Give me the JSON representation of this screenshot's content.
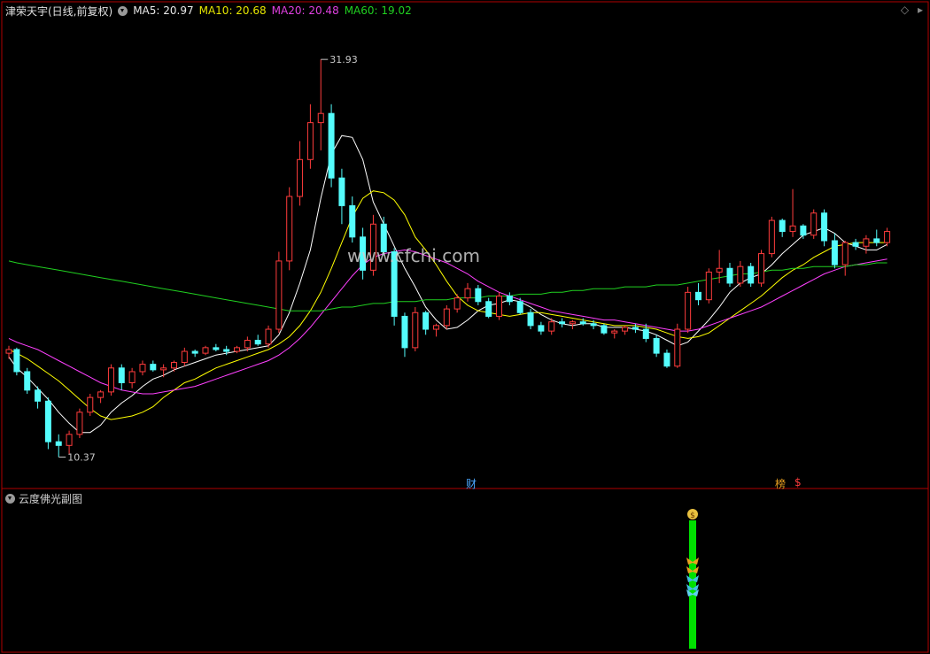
{
  "header": {
    "stock_title": "津荣天宇(日线,前复权)",
    "ma5": "MA5: 20.97",
    "ma10": "MA10: 20.68",
    "ma20": "MA20: 20.48",
    "ma60": "MA60: 19.02"
  },
  "indicator_panel": {
    "title": "云度佛光副图"
  },
  "markers": {
    "cai": "财",
    "bang": "榜",
    "dollar": "$"
  },
  "watermark": "www.cfchi.com",
  "top_right_icons": [
    "diamond-icon",
    "caret-icon"
  ],
  "colors": {
    "up": "#ff3c3c",
    "down": "#54fcfc",
    "ma5": "#ffffff",
    "ma10": "#ffff00",
    "ma20": "#ff40ff",
    "ma60": "#20d020",
    "border": "#b00000",
    "signal_bar": "#00e000"
  },
  "chart_data": {
    "type": "candlestick",
    "annotations": {
      "high_label": "31.93",
      "low_label": "10.37"
    },
    "ylim": [
      9.0,
      34.0
    ],
    "candles": [
      [
        16.0,
        16.4,
        15.7,
        16.2
      ],
      [
        16.2,
        16.3,
        14.8,
        15.0
      ],
      [
        15.0,
        15.2,
        13.8,
        14.0
      ],
      [
        14.0,
        14.2,
        13.0,
        13.4
      ],
      [
        13.4,
        13.6,
        10.8,
        11.2
      ],
      [
        11.2,
        11.6,
        10.37,
        11.0
      ],
      [
        11.0,
        11.8,
        10.5,
        11.6
      ],
      [
        11.6,
        13.0,
        11.4,
        12.8
      ],
      [
        12.8,
        13.8,
        12.6,
        13.6
      ],
      [
        13.6,
        14.0,
        13.3,
        13.9
      ],
      [
        13.9,
        15.4,
        13.7,
        15.2
      ],
      [
        15.2,
        15.4,
        14.0,
        14.4
      ],
      [
        14.4,
        15.2,
        14.1,
        15.0
      ],
      [
        15.0,
        15.6,
        14.8,
        15.4
      ],
      [
        15.4,
        15.6,
        15.0,
        15.1
      ],
      [
        15.1,
        15.4,
        14.7,
        15.2
      ],
      [
        15.2,
        15.6,
        15.0,
        15.5
      ],
      [
        15.5,
        16.3,
        15.3,
        16.1
      ],
      [
        16.1,
        16.2,
        15.8,
        16.0
      ],
      [
        16.0,
        16.4,
        15.9,
        16.3
      ],
      [
        16.3,
        16.5,
        16.1,
        16.2
      ],
      [
        16.2,
        16.4,
        15.9,
        16.1
      ],
      [
        16.1,
        16.4,
        16.0,
        16.3
      ],
      [
        16.3,
        16.9,
        16.1,
        16.7
      ],
      [
        16.7,
        17.0,
        16.4,
        16.5
      ],
      [
        16.5,
        17.5,
        16.3,
        17.3
      ],
      [
        17.3,
        21.5,
        17.1,
        21.0
      ],
      [
        21.0,
        25.0,
        20.5,
        24.5
      ],
      [
        24.5,
        27.5,
        24.0,
        26.5
      ],
      [
        26.5,
        29.5,
        26.0,
        28.5
      ],
      [
        28.5,
        31.93,
        27.0,
        29.0
      ],
      [
        29.0,
        29.5,
        25.0,
        25.5
      ],
      [
        25.5,
        26.0,
        23.0,
        24.0
      ],
      [
        24.0,
        24.5,
        22.0,
        22.3
      ],
      [
        22.3,
        22.8,
        20.0,
        20.5
      ],
      [
        20.5,
        23.5,
        20.2,
        23.0
      ],
      [
        23.0,
        23.4,
        21.3,
        21.5
      ],
      [
        21.5,
        21.7,
        17.5,
        18.0
      ],
      [
        18.0,
        18.2,
        15.8,
        16.3
      ],
      [
        16.3,
        18.5,
        16.1,
        18.2
      ],
      [
        18.2,
        18.3,
        17.0,
        17.3
      ],
      [
        17.3,
        17.6,
        16.9,
        17.5
      ],
      [
        17.5,
        18.6,
        17.3,
        18.4
      ],
      [
        18.4,
        19.2,
        18.2,
        19.0
      ],
      [
        19.0,
        19.8,
        18.8,
        19.5
      ],
      [
        19.5,
        19.7,
        18.6,
        18.8
      ],
      [
        18.8,
        19.0,
        17.9,
        18.0
      ],
      [
        18.0,
        19.3,
        17.8,
        19.1
      ],
      [
        19.1,
        19.3,
        18.6,
        18.8
      ],
      [
        18.8,
        19.0,
        18.1,
        18.2
      ],
      [
        18.2,
        18.4,
        17.3,
        17.5
      ],
      [
        17.5,
        17.7,
        17.0,
        17.2
      ],
      [
        17.2,
        17.9,
        17.0,
        17.7
      ],
      [
        17.7,
        17.9,
        17.4,
        17.6
      ],
      [
        17.6,
        17.8,
        17.3,
        17.7
      ],
      [
        17.7,
        17.9,
        17.5,
        17.6
      ],
      [
        17.6,
        17.8,
        17.3,
        17.5
      ],
      [
        17.5,
        17.6,
        17.0,
        17.1
      ],
      [
        17.1,
        17.3,
        16.8,
        17.2
      ],
      [
        17.2,
        17.5,
        17.0,
        17.4
      ],
      [
        17.4,
        17.6,
        17.1,
        17.3
      ],
      [
        17.3,
        17.6,
        16.6,
        16.8
      ],
      [
        16.8,
        17.0,
        15.8,
        16.0
      ],
      [
        16.0,
        16.2,
        15.2,
        15.3
      ],
      [
        15.3,
        17.6,
        15.2,
        17.3
      ],
      [
        17.3,
        19.6,
        17.1,
        19.3
      ],
      [
        19.3,
        19.8,
        18.6,
        18.9
      ],
      [
        18.9,
        20.6,
        18.7,
        20.4
      ],
      [
        20.4,
        21.6,
        19.8,
        20.6
      ],
      [
        20.6,
        20.9,
        19.6,
        19.8
      ],
      [
        19.8,
        21.0,
        19.6,
        20.7
      ],
      [
        20.7,
        20.9,
        19.6,
        19.8
      ],
      [
        19.8,
        21.6,
        19.6,
        21.4
      ],
      [
        21.4,
        23.4,
        21.2,
        23.2
      ],
      [
        23.2,
        23.3,
        22.3,
        22.6
      ],
      [
        22.6,
        24.9,
        22.3,
        22.9
      ],
      [
        22.9,
        23.0,
        22.2,
        22.4
      ],
      [
        22.4,
        23.8,
        22.2,
        23.6
      ],
      [
        23.6,
        23.8,
        21.8,
        22.1
      ],
      [
        22.1,
        22.5,
        20.6,
        20.8
      ],
      [
        20.8,
        22.1,
        20.2,
        22.0
      ],
      [
        22.0,
        22.2,
        21.6,
        21.8
      ],
      [
        21.8,
        22.4,
        21.4,
        22.2
      ],
      [
        22.2,
        22.7,
        21.8,
        22.0
      ],
      [
        22.0,
        22.8,
        21.8,
        22.6
      ]
    ],
    "candle_x": [
      10,
      16,
      24,
      32,
      40,
      48,
      56,
      64,
      72,
      80,
      88,
      96,
      104,
      112,
      120,
      128,
      136,
      144,
      152,
      160,
      168,
      176,
      184,
      192,
      200,
      208,
      216,
      224,
      232,
      240,
      248,
      256,
      264,
      272,
      280,
      288,
      296,
      304,
      312,
      320,
      328,
      336,
      344,
      352,
      360,
      368,
      376,
      384,
      392,
      400,
      408,
      416,
      424,
      432,
      440,
      448,
      456,
      464,
      472,
      480,
      488,
      496,
      504,
      512,
      520,
      528,
      536,
      544,
      552,
      560,
      568,
      576,
      584,
      592,
      600,
      608,
      616,
      624,
      632,
      640,
      648,
      656,
      664,
      672,
      680
    ],
    "ma_lines": [
      {
        "key": "ma5",
        "values": [
          15.8,
          15.2,
          14.7,
          14.1,
          13.5,
          12.8,
          12.2,
          11.7,
          11.7,
          12.1,
          12.8,
          13.3,
          13.7,
          14.2,
          14.6,
          14.8,
          15.1,
          15.3,
          15.5,
          15.7,
          15.9,
          16.0,
          16.1,
          16.2,
          16.3,
          16.4,
          17.0,
          18.2,
          19.8,
          21.6,
          24.4,
          26.8,
          27.8,
          27.7,
          26.5,
          24.2,
          23.0,
          21.8,
          20.6,
          19.6,
          18.5,
          17.8,
          17.3,
          17.4,
          17.8,
          18.3,
          18.6,
          18.7,
          18.9,
          18.8,
          18.5,
          18.1,
          17.8,
          17.6,
          17.5,
          17.6,
          17.6,
          17.4,
          17.4,
          17.4,
          17.3,
          17.2,
          17.0,
          16.7,
          16.4,
          16.6,
          17.2,
          17.8,
          18.5,
          19.3,
          19.8,
          20.1,
          20.3,
          20.8,
          21.4,
          21.9,
          22.4,
          22.6,
          22.8,
          22.5,
          22.0,
          21.8,
          21.6,
          21.6,
          21.9
        ]
      },
      {
        "key": "ma10",
        "values": [
          16.2,
          16.0,
          15.7,
          15.3,
          14.9,
          14.5,
          14.0,
          13.5,
          13.0,
          12.6,
          12.4,
          12.5,
          12.6,
          12.8,
          13.1,
          13.6,
          14.0,
          14.4,
          14.6,
          14.9,
          15.2,
          15.4,
          15.6,
          15.8,
          16.0,
          16.2,
          16.5,
          16.9,
          17.5,
          18.3,
          19.3,
          20.6,
          22.0,
          23.4,
          24.4,
          24.8,
          24.7,
          24.3,
          23.5,
          22.3,
          21.6,
          20.8,
          19.9,
          19.1,
          18.6,
          18.3,
          18.2,
          18.1,
          18.0,
          18.1,
          18.2,
          18.2,
          18.1,
          18.0,
          17.9,
          17.8,
          17.7,
          17.6,
          17.5,
          17.5,
          17.5,
          17.4,
          17.3,
          17.1,
          16.9,
          16.8,
          16.9,
          17.1,
          17.5,
          17.9,
          18.3,
          18.7,
          19.1,
          19.6,
          20.1,
          20.5,
          20.8,
          21.2,
          21.5,
          21.8,
          21.9,
          22.0,
          22.0,
          22.0,
          22.0
        ]
      },
      {
        "key": "ma20",
        "values": [
          16.8,
          16.6,
          16.4,
          16.2,
          15.9,
          15.6,
          15.3,
          15.0,
          14.7,
          14.4,
          14.2,
          14.0,
          13.9,
          13.8,
          13.8,
          13.9,
          14.0,
          14.1,
          14.2,
          14.4,
          14.6,
          14.8,
          15.0,
          15.2,
          15.4,
          15.6,
          15.9,
          16.3,
          16.8,
          17.4,
          18.1,
          18.8,
          19.5,
          20.2,
          20.8,
          21.2,
          21.4,
          21.5,
          21.6,
          21.5,
          21.3,
          21.1,
          20.9,
          20.6,
          20.3,
          19.9,
          19.6,
          19.3,
          19.1,
          18.9,
          18.7,
          18.5,
          18.3,
          18.2,
          18.1,
          18.0,
          17.9,
          17.8,
          17.8,
          17.7,
          17.6,
          17.5,
          17.4,
          17.3,
          17.2,
          17.2,
          17.3,
          17.5,
          17.7,
          17.9,
          18.1,
          18.3,
          18.5,
          18.8,
          19.1,
          19.4,
          19.7,
          20.0,
          20.3,
          20.5,
          20.7,
          20.8,
          20.9,
          21.0,
          21.1
        ]
      },
      {
        "key": "ma60",
        "values": [
          21.0,
          20.9,
          20.8,
          20.7,
          20.6,
          20.5,
          20.4,
          20.3,
          20.2,
          20.1,
          20.0,
          19.9,
          19.8,
          19.7,
          19.6,
          19.5,
          19.4,
          19.3,
          19.2,
          19.1,
          19.0,
          18.9,
          18.8,
          18.7,
          18.6,
          18.5,
          18.4,
          18.3,
          18.3,
          18.3,
          18.3,
          18.4,
          18.5,
          18.5,
          18.6,
          18.7,
          18.7,
          18.8,
          18.8,
          18.8,
          18.9,
          18.9,
          18.9,
          19.0,
          19.0,
          19.0,
          19.1,
          19.1,
          19.1,
          19.2,
          19.2,
          19.2,
          19.3,
          19.3,
          19.4,
          19.4,
          19.5,
          19.5,
          19.5,
          19.6,
          19.6,
          19.6,
          19.7,
          19.7,
          19.7,
          19.8,
          19.9,
          20.0,
          20.1,
          20.2,
          20.3,
          20.3,
          20.4,
          20.5,
          20.5,
          20.6,
          20.6,
          20.7,
          20.7,
          20.7,
          20.7,
          20.8,
          20.8,
          20.9,
          20.9
        ]
      }
    ]
  }
}
